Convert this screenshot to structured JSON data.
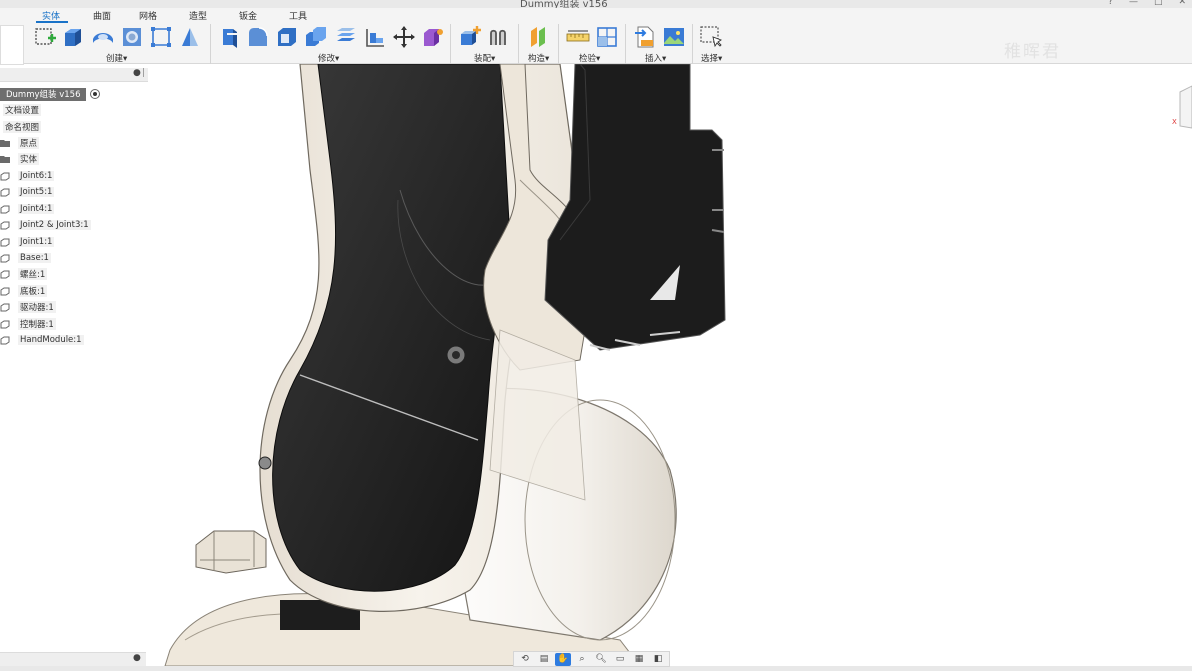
{
  "window": {
    "title": "Dummy组装 v156"
  },
  "ribbon": {
    "tabs": [
      {
        "label": "实体",
        "active": true
      },
      {
        "label": "曲面",
        "active": false
      },
      {
        "label": "网格",
        "active": false
      },
      {
        "label": "造型",
        "active": false
      },
      {
        "label": "钣金",
        "active": false
      },
      {
        "label": "工具",
        "active": false
      }
    ],
    "groups": [
      {
        "label": "创建▾"
      },
      {
        "label": "修改▾"
      },
      {
        "label": "装配▾"
      },
      {
        "label": "构造▾"
      },
      {
        "label": "检验▾"
      },
      {
        "label": "插入▾"
      },
      {
        "label": "选择▾"
      }
    ],
    "watermark": "稚晖君",
    "accent_color": "#1a73c8"
  },
  "browser": {
    "root": "Dummy组装 v156",
    "items": [
      {
        "label": "文档设置",
        "icon": "settings-icon"
      },
      {
        "label": "命名视图",
        "icon": "view-icon"
      },
      {
        "label": "原点",
        "icon": "folder-icon"
      },
      {
        "label": "实体",
        "icon": "folder-icon"
      },
      {
        "label": "Joint6:1",
        "icon": "component-icon"
      },
      {
        "label": "Joint5:1",
        "icon": "component-icon"
      },
      {
        "label": "Joint4:1",
        "icon": "component-icon"
      },
      {
        "label": "Joint2 & Joint3:1",
        "icon": "component-icon"
      },
      {
        "label": "Joint1:1",
        "icon": "component-icon"
      },
      {
        "label": "Base:1",
        "icon": "component-icon"
      },
      {
        "label": "螺丝:1",
        "icon": "component-icon"
      },
      {
        "label": "底板:1",
        "icon": "component-icon"
      },
      {
        "label": "驱动器:1",
        "icon": "component-icon"
      },
      {
        "label": "控制器:1",
        "icon": "component-icon"
      },
      {
        "label": "HandModule:1",
        "icon": "component-icon"
      }
    ]
  },
  "navbar": {
    "buttons": [
      "orbit-icon",
      "look-at-icon",
      "pan-icon",
      "zoom-window-icon",
      "zoom-icon",
      "display-settings-icon",
      "grid-icon",
      "viewports-icon"
    ],
    "active": "pan-icon",
    "active_color": "#2d7be0"
  }
}
